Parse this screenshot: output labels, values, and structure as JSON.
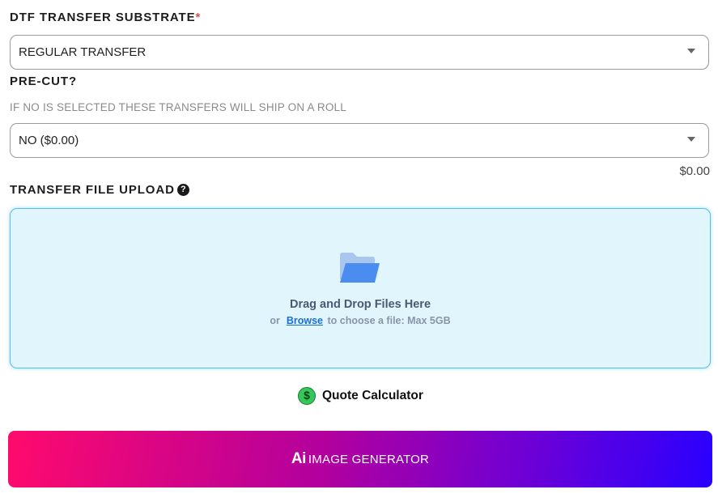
{
  "substrate": {
    "label": "DTF TRANSFER SUBSTRATE",
    "required_mark": "*",
    "selected": "REGULAR TRANSFER"
  },
  "precut": {
    "label": "PRE-CUT?",
    "hint": "IF NO IS SELECTED THESE TRANSFERS WILL SHIP ON A ROLL",
    "selected": "NO ($0.00)",
    "price": "$0.00"
  },
  "upload": {
    "label": "TRANSFER FILE UPLOAD",
    "help_icon": "?",
    "title": "Drag and Drop Files Here",
    "or": "or",
    "browse": "Browse",
    "sub": "to choose a file: Max 5GB"
  },
  "quote": {
    "icon": "$",
    "label": "Quote Calculator"
  },
  "ai_button": {
    "logo": "Ai",
    "label": "IMAGE GENERATOR"
  },
  "colors": {
    "accent": "#57c0e6",
    "dropzone_bg": "#e1f5fd",
    "gradient_start": "#ff0a6c",
    "gradient_end": "#2900ff",
    "required": "#d9534f"
  }
}
